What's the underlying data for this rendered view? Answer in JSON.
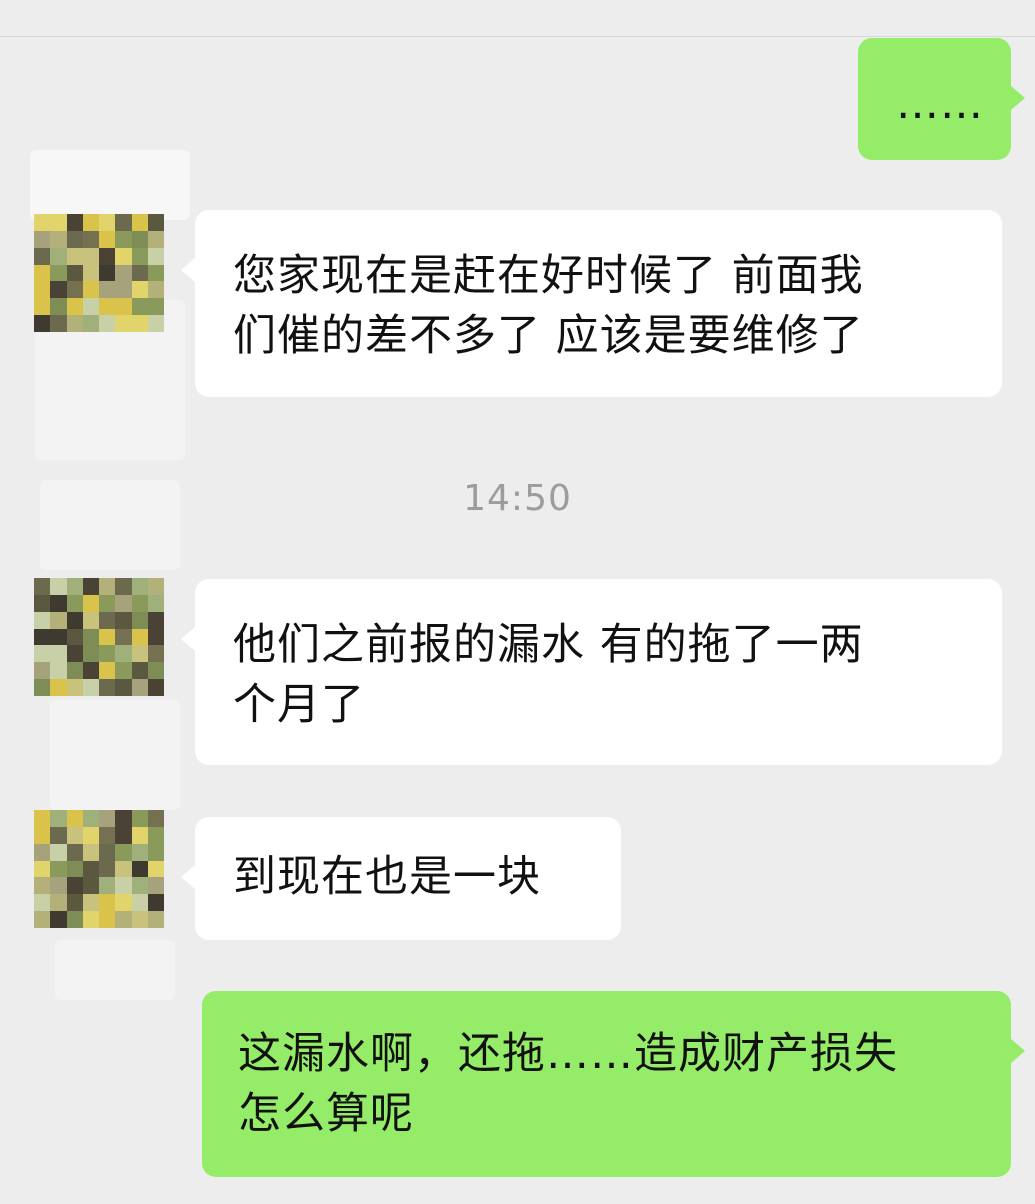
{
  "chat": {
    "timestamp": "14:50",
    "messages": [
      {
        "side": "right",
        "text": "……"
      },
      {
        "side": "left",
        "line1": "您家现在是赶在好时候了  前面我",
        "line2": "们催的差不多了 应该是要维修了"
      },
      {
        "side": "left",
        "line1": "他们之前报的漏水  有的拖了一两",
        "line2": "个月了"
      },
      {
        "side": "left",
        "text": "到现在也是一块"
      },
      {
        "side": "right",
        "line1": "这漏水啊，还拖……造成财产损失",
        "line2": "怎么算呢"
      }
    ]
  },
  "colors": {
    "background": "#ededed",
    "incoming_bubble": "#ffffff",
    "outgoing_bubble": "#95ec69",
    "timestamp": "#9c9c9c"
  },
  "avatar": {
    "description": "pixelated-mosaic-avatar"
  }
}
